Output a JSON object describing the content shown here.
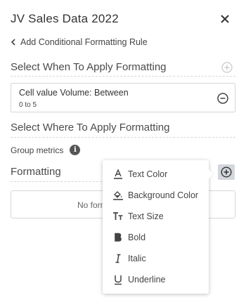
{
  "header": {
    "title": "JV Sales Data 2022"
  },
  "back": {
    "label": "Add Conditional Formatting Rule"
  },
  "sections": {
    "when": "Select When To Apply Formatting",
    "where": "Select Where To Apply Formatting",
    "formatting": "Formatting"
  },
  "rule": {
    "title": "Cell value Volume: Between",
    "subtitle": "0 to 5"
  },
  "group_metrics": {
    "label": "Group metrics",
    "info_glyph": "i"
  },
  "empty": {
    "text": "No formatting added"
  },
  "menu": {
    "items": [
      {
        "label": "Text Color",
        "icon": "text-color-icon"
      },
      {
        "label": "Background Color",
        "icon": "background-color-icon"
      },
      {
        "label": "Text Size",
        "icon": "text-size-icon"
      },
      {
        "label": "Bold",
        "icon": "bold-icon"
      },
      {
        "label": "Italic",
        "icon": "italic-icon"
      },
      {
        "label": "Underline",
        "icon": "underline-icon"
      }
    ]
  },
  "colors": {
    "accent_button": "#d3d6da",
    "text": "#444444",
    "border": "#d7d7d7"
  }
}
